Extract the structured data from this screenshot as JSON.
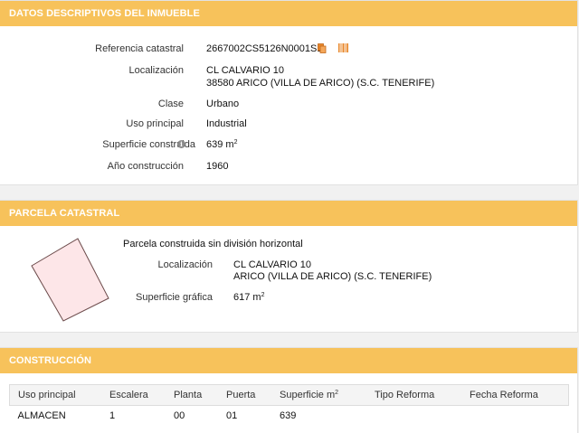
{
  "datos": {
    "header": "DATOS DESCRIPTIVOS DEL INMUEBLE",
    "referencia_label": "Referencia catastral",
    "referencia_value": "2667002CS5126N0001SB",
    "localizacion_label": "Localización",
    "localizacion_line1": "CL CALVARIO 10",
    "localizacion_line2": "38580 ARICO (VILLA DE ARICO) (S.C. TENERIFE)",
    "clase_label": "Clase",
    "clase_value": "Urbano",
    "uso_label": "Uso principal",
    "uso_value": "Industrial",
    "superficie_label": "Superficie construida",
    "superficie_value": "639 m",
    "superficie_unit_sup": "2",
    "anio_label": "Año construcción",
    "anio_value": "1960"
  },
  "parcela": {
    "header": "PARCELA CATASTRAL",
    "title": "Parcela construida sin división horizontal",
    "localizacion_label": "Localización",
    "localizacion_line1": "CL CALVARIO 10",
    "localizacion_line2": "ARICO (VILLA DE ARICO) (S.C. TENERIFE)",
    "superficie_label": "Superficie gráfica",
    "superficie_value": "617 m",
    "superficie_unit_sup": "2"
  },
  "construccion": {
    "header": "CONSTRUCCIÓN",
    "columns": [
      "Uso principal",
      "Escalera",
      "Planta",
      "Puerta",
      "Superficie m",
      "Tipo Reforma",
      "Fecha Reforma"
    ],
    "superficie_col_sup": "2",
    "rows": [
      [
        "ALMACEN",
        "1",
        "00",
        "01",
        "639",
        "",
        ""
      ]
    ]
  },
  "colors": {
    "header_bg": "#f7c25b",
    "parcel_fill": "#fde6e8",
    "parcel_stroke": "#6b4a4a",
    "icon_orange": "#e8872a"
  },
  "icons": [
    "copy-icon",
    "barcode-icon",
    "info-icon"
  ]
}
